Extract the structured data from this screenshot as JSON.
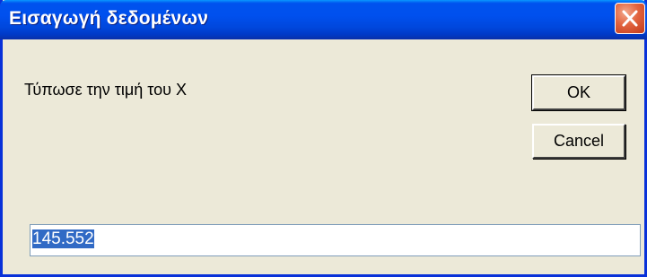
{
  "window": {
    "title": "Εισαγωγή δεδομένων"
  },
  "dialog": {
    "prompt": "Τύπωσε την τιμή του X",
    "ok_label": "OK",
    "cancel_label": "Cancel",
    "input_value": "145.552"
  },
  "icons": {
    "close": "close-icon"
  },
  "colors": {
    "titlebar": "#0053ee",
    "close_button": "#e2643f",
    "dialog_background": "#ece9d8",
    "selection": "#316ac5"
  }
}
